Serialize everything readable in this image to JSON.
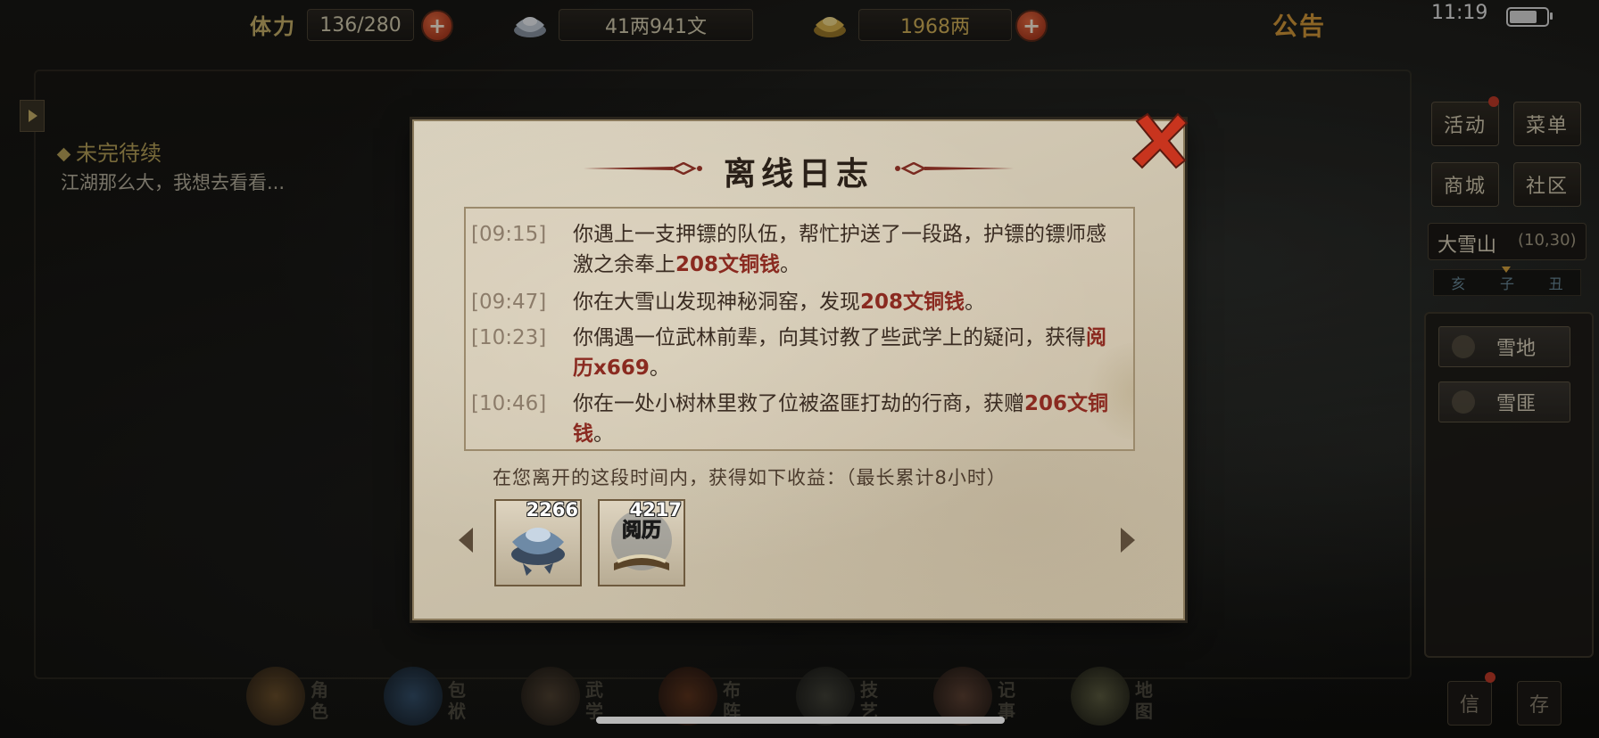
{
  "status_bar": {
    "stamina_label": "体力",
    "stamina_value": "136/280",
    "silver_value": "41两941文",
    "gold_value": "1968两",
    "notice_label": "公告",
    "time": "11:19",
    "battery_level": 0.75
  },
  "quest": {
    "title": "未完待续",
    "description": "江湖那么大，我想去看看..."
  },
  "right_panel": {
    "buttons": [
      "活动",
      "菜单",
      "商城",
      "社区"
    ],
    "location_name": "大雪山",
    "location_coord": "(10,30)",
    "time_marks": [
      "亥",
      "子",
      "丑"
    ],
    "tags": [
      "雪地",
      "雪匪"
    ],
    "corner_buttons": [
      "信",
      "存"
    ]
  },
  "bottom_nav": [
    {
      "label": "角色",
      "icon": "character-icon"
    },
    {
      "label": "包袱",
      "icon": "bag-icon"
    },
    {
      "label": "武学",
      "icon": "martial-arts-icon"
    },
    {
      "label": "布阵",
      "icon": "formation-icon"
    },
    {
      "label": "技艺",
      "icon": "skill-icon"
    },
    {
      "label": "记事",
      "icon": "journal-icon"
    },
    {
      "label": "地图",
      "icon": "map-icon"
    }
  ],
  "dialog": {
    "title": "离线日志",
    "entries": [
      {
        "time": "[09:15]",
        "parts": [
          {
            "t": "你遇上一支押镖的队伍，帮忙护送了一段路，护镖的镖师感激之余奉上",
            "hl": false
          },
          {
            "t": "208文铜钱",
            "hl": true
          },
          {
            "t": "。",
            "hl": false
          }
        ]
      },
      {
        "time": "[09:47]",
        "parts": [
          {
            "t": "你在大雪山发现神秘洞窑，发现",
            "hl": false
          },
          {
            "t": "208文铜钱",
            "hl": true
          },
          {
            "t": "。",
            "hl": false
          }
        ]
      },
      {
        "time": "[10:23]",
        "parts": [
          {
            "t": "你偶遇一位武林前辈，向其讨教了些武学上的疑问，获得",
            "hl": false
          },
          {
            "t": "阅历x669",
            "hl": true
          },
          {
            "t": "。",
            "hl": false
          }
        ]
      },
      {
        "time": "[10:46]",
        "parts": [
          {
            "t": "你在一处小树林里救了位被盗匪打劫的行商，获赠",
            "hl": false
          },
          {
            "t": "206文铜钱",
            "hl": true
          },
          {
            "t": "。",
            "hl": false
          }
        ]
      }
    ],
    "summary": "在您离开的这段时间内，获得如下收益：（最长累计8小时）",
    "rewards": [
      {
        "count": "2266",
        "icon": "silver-ingot-icon"
      },
      {
        "count": "4217",
        "icon": "experience-book-icon",
        "text": "阅历"
      }
    ]
  },
  "colors": {
    "parchment": "#cfc5af",
    "highlight": "#8a2a20",
    "gold_text": "#c9b36a",
    "notice": "#d69a3a"
  }
}
